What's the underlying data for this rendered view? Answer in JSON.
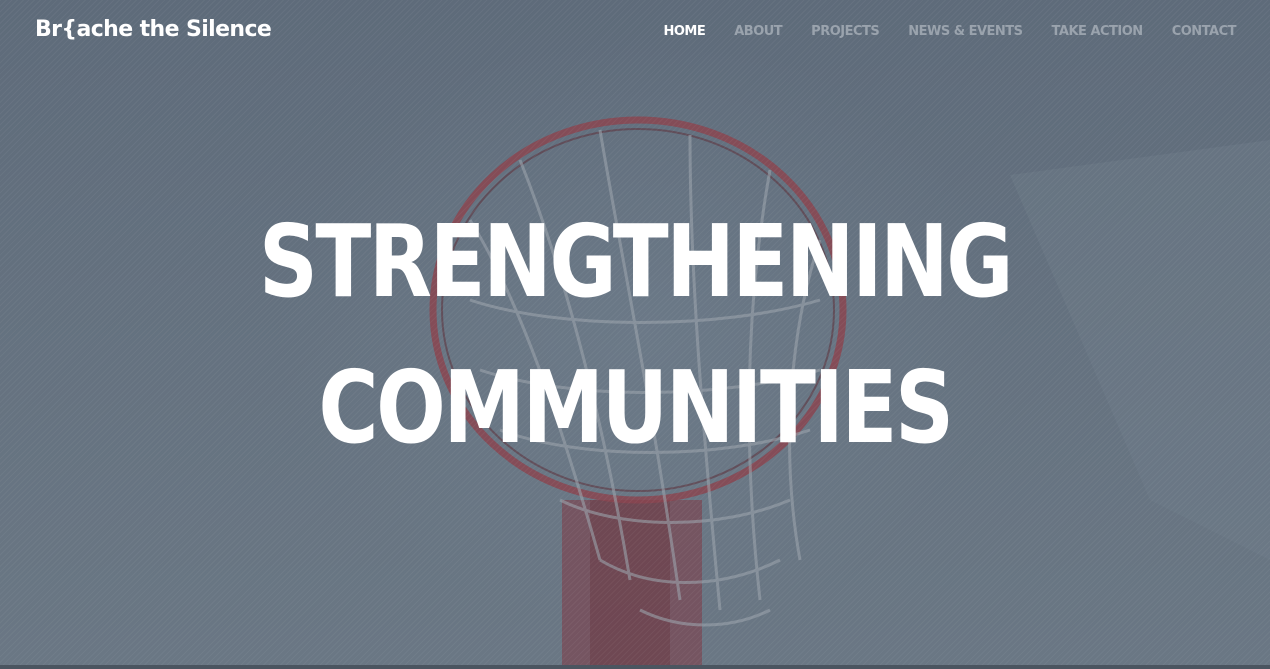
{
  "brand": {
    "name": "Br{ache the Silence"
  },
  "nav": {
    "items": [
      {
        "label": "HOME",
        "active": true
      },
      {
        "label": "ABOUT",
        "active": false
      },
      {
        "label": "PROJECTS",
        "active": false
      },
      {
        "label": "NEWS & EVENTS",
        "active": false
      },
      {
        "label": "TAKE ACTION",
        "active": false
      },
      {
        "label": "CONTACT",
        "active": false
      }
    ]
  },
  "hero": {
    "headline_line1": "STRENGTHENING",
    "headline_line2": "COMMUNITIES",
    "background_image": "basketball-hoop-photo"
  },
  "colors": {
    "overlay": "#5e6b7a",
    "nav_active": "#ffffff",
    "nav_inactive": "#9aa3ad",
    "rim": "#8a4550"
  }
}
